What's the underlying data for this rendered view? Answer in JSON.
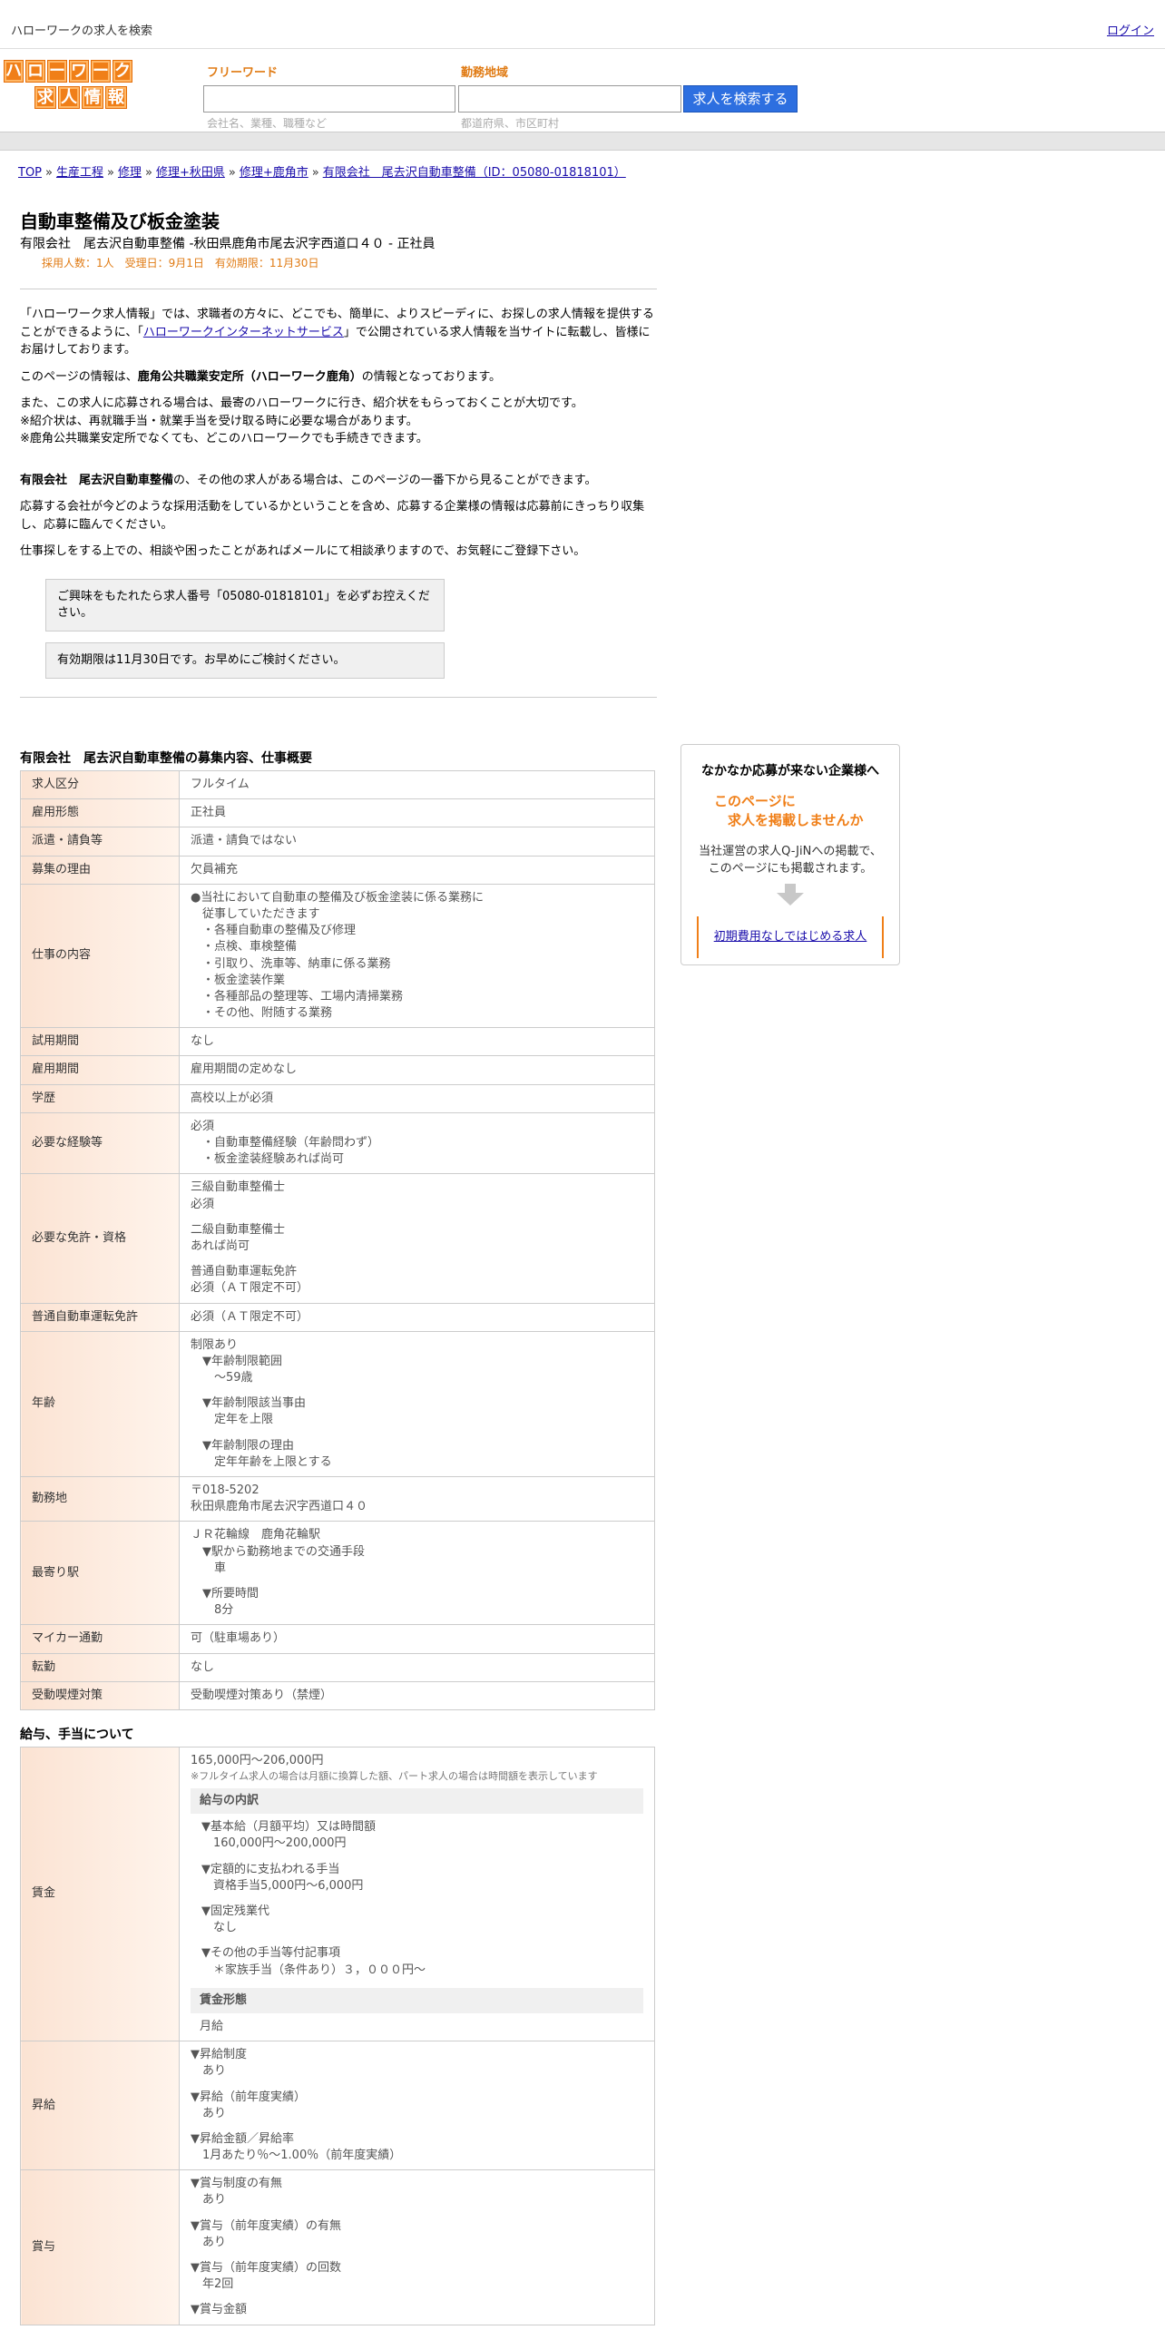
{
  "header": {
    "title": "ハローワークの求人を検索",
    "login": "ログイン"
  },
  "logo": {
    "row1": [
      "ハ",
      "ロ",
      "ー",
      "ワ",
      "ー",
      "ク"
    ],
    "row2": [
      "求",
      "人",
      "情",
      "報"
    ]
  },
  "search": {
    "free_label": "フリーワード",
    "free_hint": "会社名、業種、職種など",
    "area_label": "勤務地域",
    "area_hint": "都道府県、市区町村",
    "button": "求人を検索する"
  },
  "breadcrumb": {
    "items": [
      "TOP",
      "生産工程",
      "修理",
      "修理+秋田県",
      "修理+鹿角市",
      "有限会社　尾去沢自動車整備（ID：05080-01818101）"
    ],
    "separator": "»"
  },
  "job": {
    "title": "自動車整備及び板金塗装",
    "subtitle": "有限会社　尾去沢自動車整備 -秋田県鹿角市尾去沢字西道口４０ - 正社員",
    "meta": "採用人数：1人　受理日：9月1日　有効期限：11月30日"
  },
  "intro": {
    "p1a": "「ハローワーク求人情報」では、求職者の方々に、どこでも、簡単に、よりスピーディに、お探しの求人情報を提供することができるように、「",
    "p1link": "ハローワークインターネットサービス",
    "p1b": "」で公開されている求人情報を当サイトに転載し、皆様にお届けしております。",
    "p2a": "このページの情報は、",
    "p2b": "鹿角公共職業安定所（ハローワーク鹿角）",
    "p2c": "の情報となっております。",
    "p3": [
      "また、この求人に応募される場合は、最寄のハローワークに行き、紹介状をもらっておくことが大切です。",
      "※紹介状は、再就職手当・就業手当を受け取る時に必要な場合があります。",
      "※鹿角公共職業安定所でなくても、どこのハローワークでも手続きできます。"
    ],
    "p4a": "有限会社　尾去沢自動車整備",
    "p4b": "の、その他の求人がある場合は、このページの一番下から見ることができます。",
    "p5": "応募する会社が今どのような採用活動をしているかということを含め、応募する企業様の情報は応募前にきっちり収集し、応募に臨んでください。",
    "p6": "仕事探しをする上での、相談や困ったことがあればメールにて相談承りますので、お気軽にご登録下さい。",
    "notice1": "ご興味をもたれたら求人番号「05080-01818101」を必ずお控えください。",
    "notice2": "有効期限は11月30日です。お早めにご検討ください。"
  },
  "section1": {
    "title": "有限会社　尾去沢自動車整備の募集内容、仕事概要",
    "rows": [
      {
        "k": "求人区分",
        "v": [
          "フルタイム"
        ]
      },
      {
        "k": "雇用形態",
        "v": [
          "正社員"
        ]
      },
      {
        "k": "派遣・請負等",
        "v": [
          "派遣・請負ではない"
        ]
      },
      {
        "k": "募集の理由",
        "v": [
          "欠員補充"
        ]
      },
      {
        "k": "仕事の内容",
        "v": [
          "●当社において自動車の整備及び板金塗装に係る業務に",
          "　従事していただきます",
          "　・各種自動車の整備及び修理",
          "　・点検、車検整備",
          "　・引取り、洗車等、納車に係る業務",
          "　・板金塗装作業",
          "　・各種部品の整理等、工場内清掃業務",
          "　・その他、附随する業務"
        ]
      },
      {
        "k": "試用期間",
        "v": [
          "なし"
        ]
      },
      {
        "k": "雇用期間",
        "v": [
          "雇用期間の定めなし"
        ]
      },
      {
        "k": "学歴",
        "v": [
          "高校以上が必須"
        ]
      },
      {
        "k": "必要な経験等",
        "v": [
          "必須",
          "　・自動車整備経験（年齢問わず）",
          "　・板金塗装経験あれば尚可"
        ]
      },
      {
        "k": "必要な免許・資格",
        "v": [
          "三級自動車整備士",
          "必須",
          "",
          "二級自動車整備士",
          "あれば尚可",
          "",
          "普通自動車運転免許",
          "必須（ＡＴ限定不可）"
        ]
      },
      {
        "k": "普通自動車運転免許",
        "v": [
          "必須（ＡＴ限定不可）"
        ]
      },
      {
        "k": "年齢",
        "v": [
          "制限あり",
          "　▼年齢制限範囲",
          "　　〜59歳",
          "",
          "　▼年齢制限該当事由",
          "　　定年を上限",
          "",
          "　▼年齢制限の理由",
          "　　定年年齢を上限とする"
        ]
      },
      {
        "k": "勤務地",
        "v": [
          "〒018-5202",
          "秋田県鹿角市尾去沢字西道口４０"
        ]
      },
      {
        "k": "最寄り駅",
        "v": [
          "ＪＲ花輪線　鹿角花輪駅",
          "　▼駅から勤務地までの交通手段",
          "　　車",
          "",
          "　▼所要時間",
          "　　8分"
        ]
      },
      {
        "k": "マイカー通勤",
        "v": [
          "可（駐車場あり）"
        ]
      },
      {
        "k": "転勤",
        "v": [
          "なし"
        ]
      },
      {
        "k": "受動喫煙対策",
        "v": [
          "受動喫煙対策あり（禁煙）"
        ]
      }
    ]
  },
  "section2": {
    "title": "給与、手当について",
    "wage_key": "賃金",
    "wage_amount": "165,000円〜206,000円",
    "wage_note": "※フルタイム求人の場合は月額に換算した額、パート求人の場合は時間額を表示しています",
    "breakdown_title": "給与の内訳",
    "breakdown": [
      "▼基本給（月額平均）又は時間額",
      "　160,000円〜200,000円",
      "",
      "▼定額的に支払われる手当",
      "　資格手当5,000円〜6,000円",
      "",
      "▼固定残業代",
      "　なし",
      "",
      "▼その他の手当等付記事項",
      "　＊家族手当（条件あり）３，０００円〜"
    ],
    "form_title": "賃金形態",
    "form_value": "月給",
    "raise_key": "昇給",
    "raise": [
      "▼昇給制度",
      "　あり",
      "",
      "▼昇給（前年度実績）",
      "　あり",
      "",
      "▼昇給金額／昇給率",
      "　1月あたり％〜1.00％（前年度実績）"
    ],
    "bonus_key": "賞与",
    "bonus": [
      "▼賞与制度の有無",
      "　あり",
      "",
      "▼賞与（前年度実績）の有無",
      "　あり",
      "",
      "▼賞与（前年度実績）の回数",
      "　年2回",
      "",
      "▼賞与金額"
    ]
  },
  "side": {
    "heading": "なかなか応募が来ない企業様へ",
    "offer1": "このページに",
    "offer2": "　求人を掲載しませんか",
    "desc1": "当社運営の求人Q-JiNへの掲載で、",
    "desc2": "このページにも掲載されます。",
    "cta": "初期費用なしではじめる求人"
  }
}
